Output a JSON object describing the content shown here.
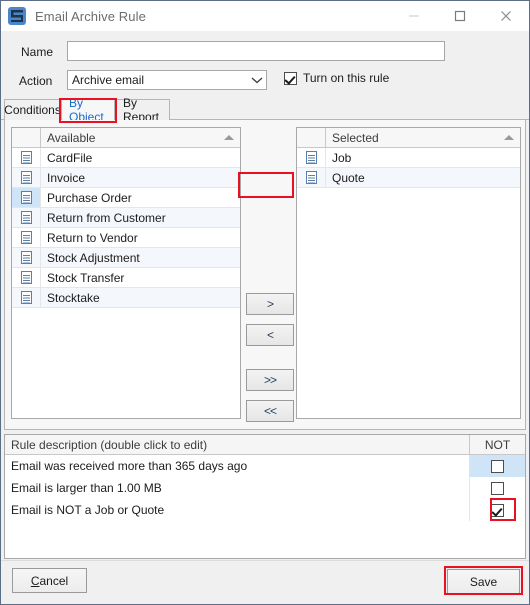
{
  "window": {
    "title": "Email Archive Rule",
    "icon": "email-app-icon",
    "controls": {
      "minimize": "minimize-icon",
      "maximize": "maximize-icon",
      "close": "close-icon"
    }
  },
  "form": {
    "name_label": "Name",
    "name_value": "",
    "name_placeholder": "",
    "action_label": "Action",
    "action_value": "Archive email",
    "turn_on_label": "Turn on this rule",
    "turn_on_checked": true
  },
  "tabs": [
    {
      "label": "Conditions",
      "active": false
    },
    {
      "label": "By Object",
      "active": true
    },
    {
      "label": "By Report",
      "active": false
    }
  ],
  "available_list": {
    "header": "Available",
    "sort": "ascending",
    "items": [
      {
        "label": "CardFile",
        "current": false
      },
      {
        "label": "Invoice",
        "current": false
      },
      {
        "label": "Purchase Order",
        "current": true
      },
      {
        "label": "Return from Customer",
        "current": false
      },
      {
        "label": "Return to Vendor",
        "current": false
      },
      {
        "label": "Stock Adjustment",
        "current": false
      },
      {
        "label": "Stock Transfer",
        "current": false
      },
      {
        "label": "Stocktake",
        "current": false
      }
    ]
  },
  "selected_list": {
    "header": "Selected",
    "sort": "ascending",
    "items": [
      {
        "label": "Job",
        "current": false
      },
      {
        "label": "Quote",
        "current": false
      }
    ]
  },
  "transfer_buttons": {
    "add": ">",
    "remove": "<",
    "add_all": ">>",
    "remove_all": "<<"
  },
  "rule_description": {
    "header_description": "Rule description (double click to edit)",
    "header_not": "NOT",
    "rows": [
      {
        "text": "Email was received more than 365 days ago",
        "not": false,
        "current": true
      },
      {
        "text": "Email is larger than 1.00 MB",
        "not": false,
        "current": false
      },
      {
        "text": "Email is NOT a Job or Quote",
        "not": true,
        "current": false
      }
    ]
  },
  "footer": {
    "cancel_accel": "C",
    "cancel_rest": "ancel",
    "save_label": "Save"
  },
  "annotations": {
    "accent_color": "#e81123",
    "highlighted": [
      "tab-by-object",
      "add-button",
      "not-checkbox-row-3",
      "save-button"
    ]
  }
}
